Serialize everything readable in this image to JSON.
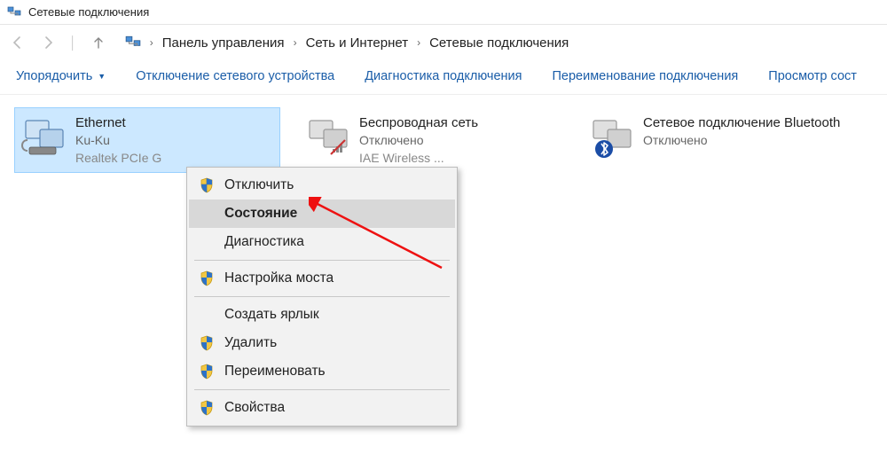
{
  "window": {
    "title": "Сетевые подключения"
  },
  "breadcrumb": {
    "items": [
      "Панель управления",
      "Сеть и Интернет",
      "Сетевые подключения"
    ]
  },
  "toolbar": {
    "organize": "Упорядочить",
    "disable": "Отключение сетевого устройства",
    "diagnose": "Диагностика подключения",
    "rename": "Переименование подключения",
    "view_status": "Просмотр сост"
  },
  "connections": [
    {
      "name": "Ethernet",
      "line2": "Ku-Ku",
      "line3": "Realtek PCIe G"
    },
    {
      "name": "Беспроводная сеть",
      "line2": "Отключено",
      "line3": "IAE Wireless ..."
    },
    {
      "name": "Сетевое подключение Bluetooth",
      "line2": "Отключено",
      "line3": ""
    }
  ],
  "context_menu": {
    "disable": "Отключить",
    "status": "Состояние",
    "diagnose": "Диагностика",
    "bridge": "Настройка моста",
    "shortcut": "Создать ярлык",
    "delete": "Удалить",
    "rename": "Переименовать",
    "properties": "Свойства"
  }
}
